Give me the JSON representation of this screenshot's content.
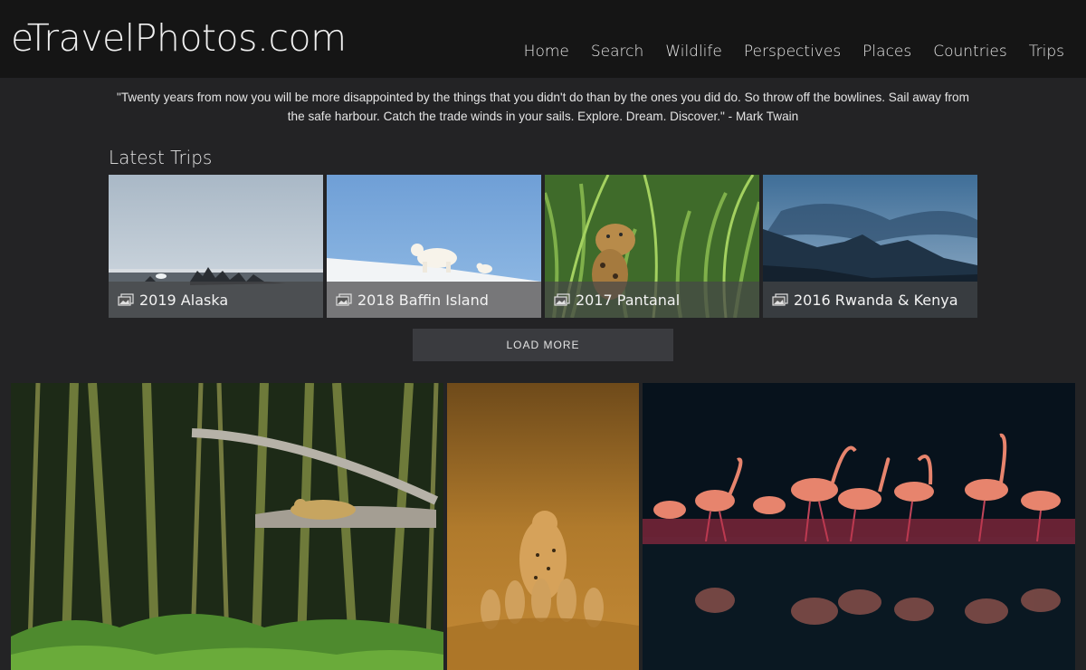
{
  "site": {
    "logo": "eTravelPhotos.com"
  },
  "nav": [
    "Home",
    "Search",
    "Wildlife",
    "Perspectives",
    "Places",
    "Countries",
    "Trips"
  ],
  "quote": "\"Twenty years from now you will be more disappointed by the things that you didn't do than by the ones you did do. So throw off the bowlines. Sail away from the safe harbour. Catch the trade winds in your sails. Explore. Dream. Discover.\" - Mark Twain",
  "latest_trips": {
    "title": "Latest Trips",
    "items": [
      {
        "label": "2019 Alaska"
      },
      {
        "label": "2018 Baffin Island"
      },
      {
        "label": "2017 Pantanal"
      },
      {
        "label": "2016 Rwanda & Kenya"
      }
    ],
    "load_more": "LOAD MORE"
  },
  "icons": {
    "trip_caption": "gallery-icon"
  },
  "colors": {
    "background": "#232325",
    "header": "#151515",
    "button": "#3a3b3f"
  }
}
